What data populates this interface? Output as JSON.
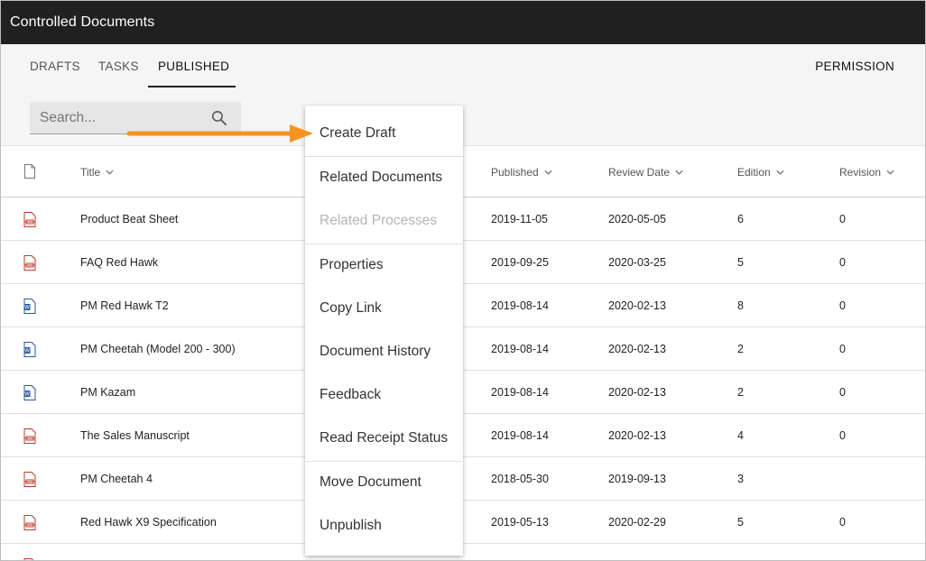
{
  "app": {
    "title": "Controlled Documents"
  },
  "tabs": [
    {
      "label": "DRAFTS",
      "active": false
    },
    {
      "label": "TASKS",
      "active": false
    },
    {
      "label": "PUBLISHED",
      "active": true
    }
  ],
  "permission_label": "PERMISSION",
  "search": {
    "placeholder": "Search..."
  },
  "columns": {
    "title": "Title",
    "published": "Published",
    "review_date": "Review Date",
    "edition": "Edition",
    "revision": "Revision"
  },
  "rows": [
    {
      "icon": "pdf-file-icon",
      "title": "Product Beat Sheet",
      "published": "2019-11-05",
      "review_date": "2020-05-05",
      "edition": "6",
      "revision": "0"
    },
    {
      "icon": "pdf-file-icon",
      "title": "FAQ Red Hawk",
      "published": "2019-09-25",
      "review_date": "2020-03-25",
      "edition": "5",
      "revision": "0"
    },
    {
      "icon": "word-file-icon",
      "title": "PM Red Hawk T2",
      "published": "2019-08-14",
      "review_date": "2020-02-13",
      "edition": "8",
      "revision": "0"
    },
    {
      "icon": "word-file-icon",
      "title": "PM Cheetah (Model 200 - 300)",
      "published": "2019-08-14",
      "review_date": "2020-02-13",
      "edition": "2",
      "revision": "0"
    },
    {
      "icon": "word-file-icon",
      "title": "PM Kazam",
      "published": "2019-08-14",
      "review_date": "2020-02-13",
      "edition": "2",
      "revision": "0"
    },
    {
      "icon": "pdf-file-icon",
      "title": "The Sales Manuscript",
      "published": "2019-08-14",
      "review_date": "2020-02-13",
      "edition": "4",
      "revision": "0"
    },
    {
      "icon": "pdf-file-icon",
      "title": "PM Cheetah 4",
      "published": "2018-05-30",
      "review_date": "2019-09-13",
      "edition": "3",
      "revision": ""
    },
    {
      "icon": "pdf-file-icon",
      "title": "Red Hawk X9 Specification",
      "published": "2019-05-13",
      "review_date": "2020-02-29",
      "edition": "5",
      "revision": "0"
    }
  ],
  "context_menu": {
    "items": [
      {
        "label": "Create Draft",
        "enabled": true
      },
      {
        "label": "Related Documents",
        "enabled": true
      },
      {
        "label": "Related Processes",
        "enabled": false
      },
      {
        "label": "Properties",
        "enabled": true
      },
      {
        "label": "Copy Link",
        "enabled": true
      },
      {
        "label": "Document History",
        "enabled": true
      },
      {
        "label": "Feedback",
        "enabled": true
      },
      {
        "label": "Read Receipt Status",
        "enabled": true
      },
      {
        "label": "Move Document",
        "enabled": true
      },
      {
        "label": "Unpublish",
        "enabled": true
      }
    ]
  },
  "colors": {
    "appbar": "#202020",
    "tabs_background": "#f5f5f5",
    "annotation_arrow": "#f7931e",
    "pdf_icon": "#c0392b",
    "word_icon": "#2b5797"
  }
}
